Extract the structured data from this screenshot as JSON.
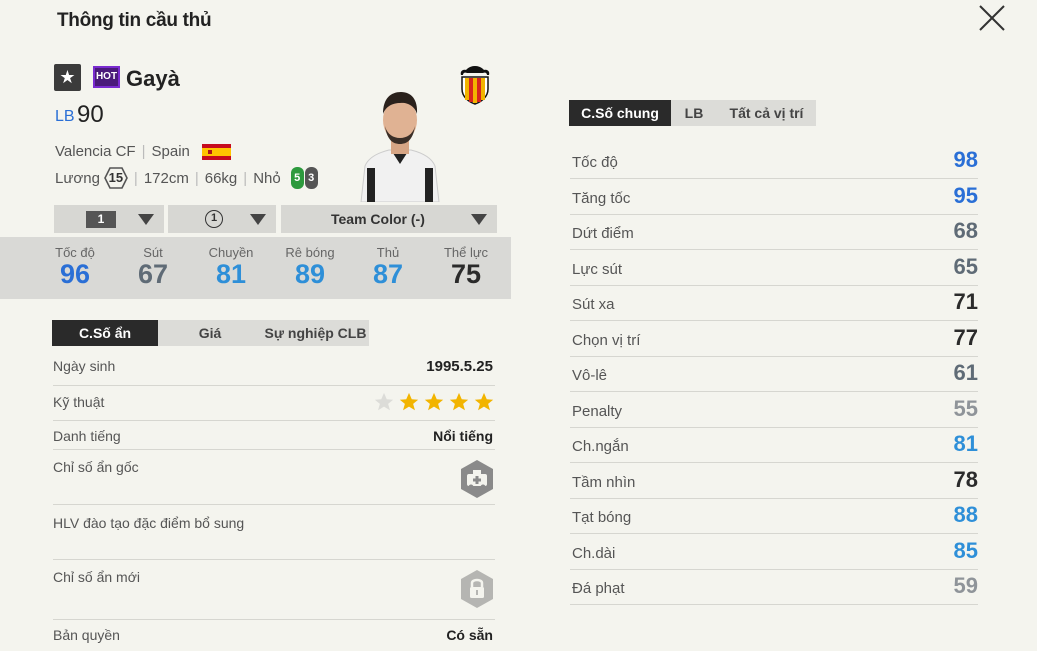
{
  "header": {
    "title": "Thông tin cầu thủ"
  },
  "player": {
    "name": "Gayà",
    "hot_label": "HOT",
    "position": "LB",
    "ovr": "90",
    "club": "Valencia CF",
    "nation": "Spain",
    "wage_label": "Lương",
    "wage": "15",
    "height": "172cm",
    "weight": "66kg",
    "body": "Nhỏ",
    "foot_left": "5",
    "foot_right": "3"
  },
  "selectors": {
    "level": "1",
    "upgrade": "1",
    "team_color": "Team Color (-)"
  },
  "summary_stats": [
    {
      "label": "Tốc độ",
      "value": "96",
      "color": "#2a6fd6"
    },
    {
      "label": "Sút",
      "value": "67",
      "color": "#5f6b76"
    },
    {
      "label": "Chuyền",
      "value": "81",
      "color": "#2e8fd8"
    },
    {
      "label": "Rê bóng",
      "value": "89",
      "color": "#2e8fd8"
    },
    {
      "label": "Thủ",
      "value": "87",
      "color": "#2e8fd8"
    },
    {
      "label": "Thể lực",
      "value": "75",
      "color": "#2b2b2b"
    }
  ],
  "left_tabs": [
    "C.Số ẩn",
    "Giá",
    "Sự nghiệp CLB"
  ],
  "info": {
    "birth_label": "Ngày sinh",
    "birth": "1995.5.25",
    "skill_label": "Kỹ thuật",
    "skill_stars": 4,
    "rep_label": "Danh tiếng",
    "rep": "Nổi tiếng",
    "hidden_orig_label": "Chỉ số ẩn gốc",
    "coach_label": "HLV đào tạo đặc điểm bổ sung",
    "hidden_new_label": "Chỉ số ẩn mới",
    "license_label": "Bản quyền",
    "license": "Có sẵn"
  },
  "right_tabs": [
    "C.Số chung",
    "LB",
    "Tất cả vị trí"
  ],
  "detail_stats": [
    {
      "label": "Tốc độ",
      "value": "98",
      "color": "#2a6fd6"
    },
    {
      "label": "Tăng tốc",
      "value": "95",
      "color": "#2a6fd6"
    },
    {
      "label": "Dứt điểm",
      "value": "68",
      "color": "#5f6b76"
    },
    {
      "label": "Lực sút",
      "value": "65",
      "color": "#5f6b76"
    },
    {
      "label": "Sút xa",
      "value": "71",
      "color": "#2b2b2b"
    },
    {
      "label": "Chọn vị trí",
      "value": "77",
      "color": "#2b2b2b"
    },
    {
      "label": "Vô-lê",
      "value": "61",
      "color": "#5f6b76"
    },
    {
      "label": "Penalty",
      "value": "55",
      "color": "#8f9499"
    },
    {
      "label": "Ch.ngắn",
      "value": "81",
      "color": "#2e8fd8"
    },
    {
      "label": "Tầm nhìn",
      "value": "78",
      "color": "#2b2b2b"
    },
    {
      "label": "Tạt bóng",
      "value": "88",
      "color": "#2e8fd8"
    },
    {
      "label": "Ch.dài",
      "value": "85",
      "color": "#2e8fd8"
    },
    {
      "label": "Đá phạt",
      "value": "59",
      "color": "#8f9499"
    }
  ]
}
